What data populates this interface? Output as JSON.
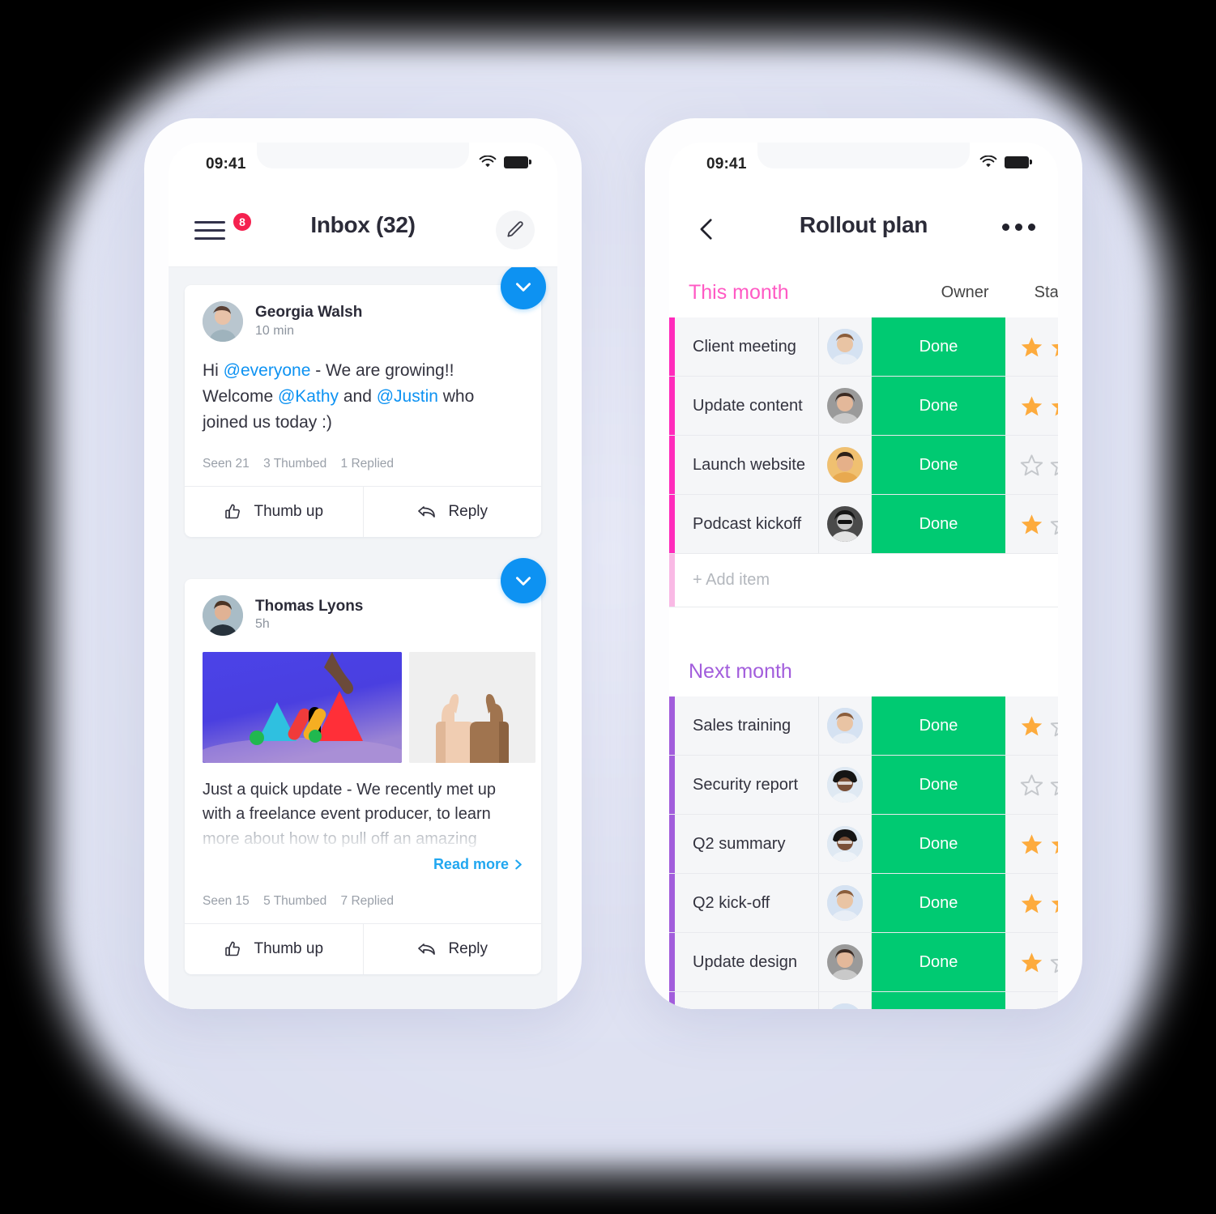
{
  "canvas": {
    "background_color": "#dadeef",
    "accent_blue": "#0d92f2",
    "accent_green": "#00ca72",
    "accent_pink": "#ff5ac4",
    "accent_purple": "#a25ddc",
    "badge_red": "#f5214f"
  },
  "left_phone": {
    "status_bar": {
      "time": "09:41",
      "wifi_icon": "wifi-icon",
      "battery_icon": "battery-icon"
    },
    "nav": {
      "menu_icon": "hamburger-menu-icon",
      "menu_badge": "8",
      "title": "Inbox (32)",
      "compose_icon": "pencil-edit-icon"
    },
    "posts": [
      {
        "check_icon": "check-circle-icon",
        "author": "Georgia Walsh",
        "time": "10 min",
        "avatar_name": "avatar-georgia-walsh",
        "body_parts": [
          {
            "text": "Hi ",
            "type": "plain"
          },
          {
            "text": "@everyone",
            "type": "mention"
          },
          {
            "text": " - We are growing!! Welcome ",
            "type": "plain"
          },
          {
            "text": "@Kathy",
            "type": "mention"
          },
          {
            "text": " and ",
            "type": "plain"
          },
          {
            "text": "@Justin",
            "type": "mention"
          },
          {
            "text": " who joined us today :)",
            "type": "plain"
          }
        ],
        "meta": {
          "seen": "Seen 21",
          "thumbed": "3  Thumbed",
          "replied": "1 Replied"
        },
        "actions": [
          {
            "label": "Thumb up",
            "icon": "thumb-up-icon"
          },
          {
            "label": "Reply",
            "icon": "reply-arrow-icon"
          }
        ]
      },
      {
        "check_icon": "check-circle-icon",
        "author": "Thomas Lyons",
        "time": "5h",
        "avatar_name": "avatar-thomas-lyons",
        "media": [
          {
            "name": "image-shapes-hand",
            "alt": "abstract shapes with hand on blue background"
          },
          {
            "name": "image-thumbs-up",
            "alt": "two thumbs up hands"
          }
        ],
        "body_line1": "Just a quick update - We recently met up",
        "body_line2": "with a freelance event producer, to learn",
        "body_line3_faded": "more about how to pull off an amazing",
        "read_more": "Read more",
        "read_more_icon": "chevron-right-icon",
        "meta": {
          "seen": "Seen 15",
          "thumbed": "5  Thumbed",
          "replied": "7 Replied"
        },
        "actions": [
          {
            "label": "Thumb up",
            "icon": "thumb-up-icon"
          },
          {
            "label": "Reply",
            "icon": "reply-arrow-icon"
          }
        ]
      }
    ]
  },
  "right_phone": {
    "status_bar": {
      "time": "09:41",
      "wifi_icon": "wifi-icon",
      "battery_icon": "battery-icon"
    },
    "nav": {
      "back_icon": "chevron-left-icon",
      "title": "Rollout plan",
      "more_icon": "more-horizontal-icon"
    },
    "columns": {
      "owner": "Owner",
      "status": "Status"
    },
    "groups": [
      {
        "title": "This month",
        "color": "#ff5ac4",
        "accent": "pink",
        "add_item_label": "+ Add item",
        "rows": [
          {
            "name": "Client meeting",
            "owner_avatar": "avatar-owner-1",
            "status": "Done",
            "stars": [
              true,
              true
            ]
          },
          {
            "name": "Update content",
            "owner_avatar": "avatar-owner-2",
            "status": "Done",
            "stars": [
              true,
              true
            ]
          },
          {
            "name": "Launch website",
            "owner_avatar": "avatar-owner-3",
            "status": "Done",
            "stars": [
              false,
              false
            ]
          },
          {
            "name": "Podcast kickoff",
            "owner_avatar": "avatar-owner-4",
            "status": "Done",
            "stars": [
              true,
              false
            ]
          }
        ]
      },
      {
        "title": "Next month",
        "color": "#a25ddc",
        "accent": "purple",
        "rows": [
          {
            "name": "Sales training",
            "owner_avatar": "avatar-owner-1",
            "status": "Done",
            "stars": [
              true,
              false
            ]
          },
          {
            "name": "Security report",
            "owner_avatar": "avatar-owner-5",
            "status": "Done",
            "stars": [
              false,
              false
            ]
          },
          {
            "name": "Q2 summary",
            "owner_avatar": "avatar-owner-5",
            "status": "Done",
            "stars": [
              true,
              true
            ]
          },
          {
            "name": "Q2 kick-off",
            "owner_avatar": "avatar-owner-1",
            "status": "Done",
            "stars": [
              true,
              true
            ]
          },
          {
            "name": "Update design",
            "owner_avatar": "avatar-owner-2",
            "status": "Done",
            "stars": [
              true,
              false
            ]
          }
        ]
      }
    ]
  }
}
